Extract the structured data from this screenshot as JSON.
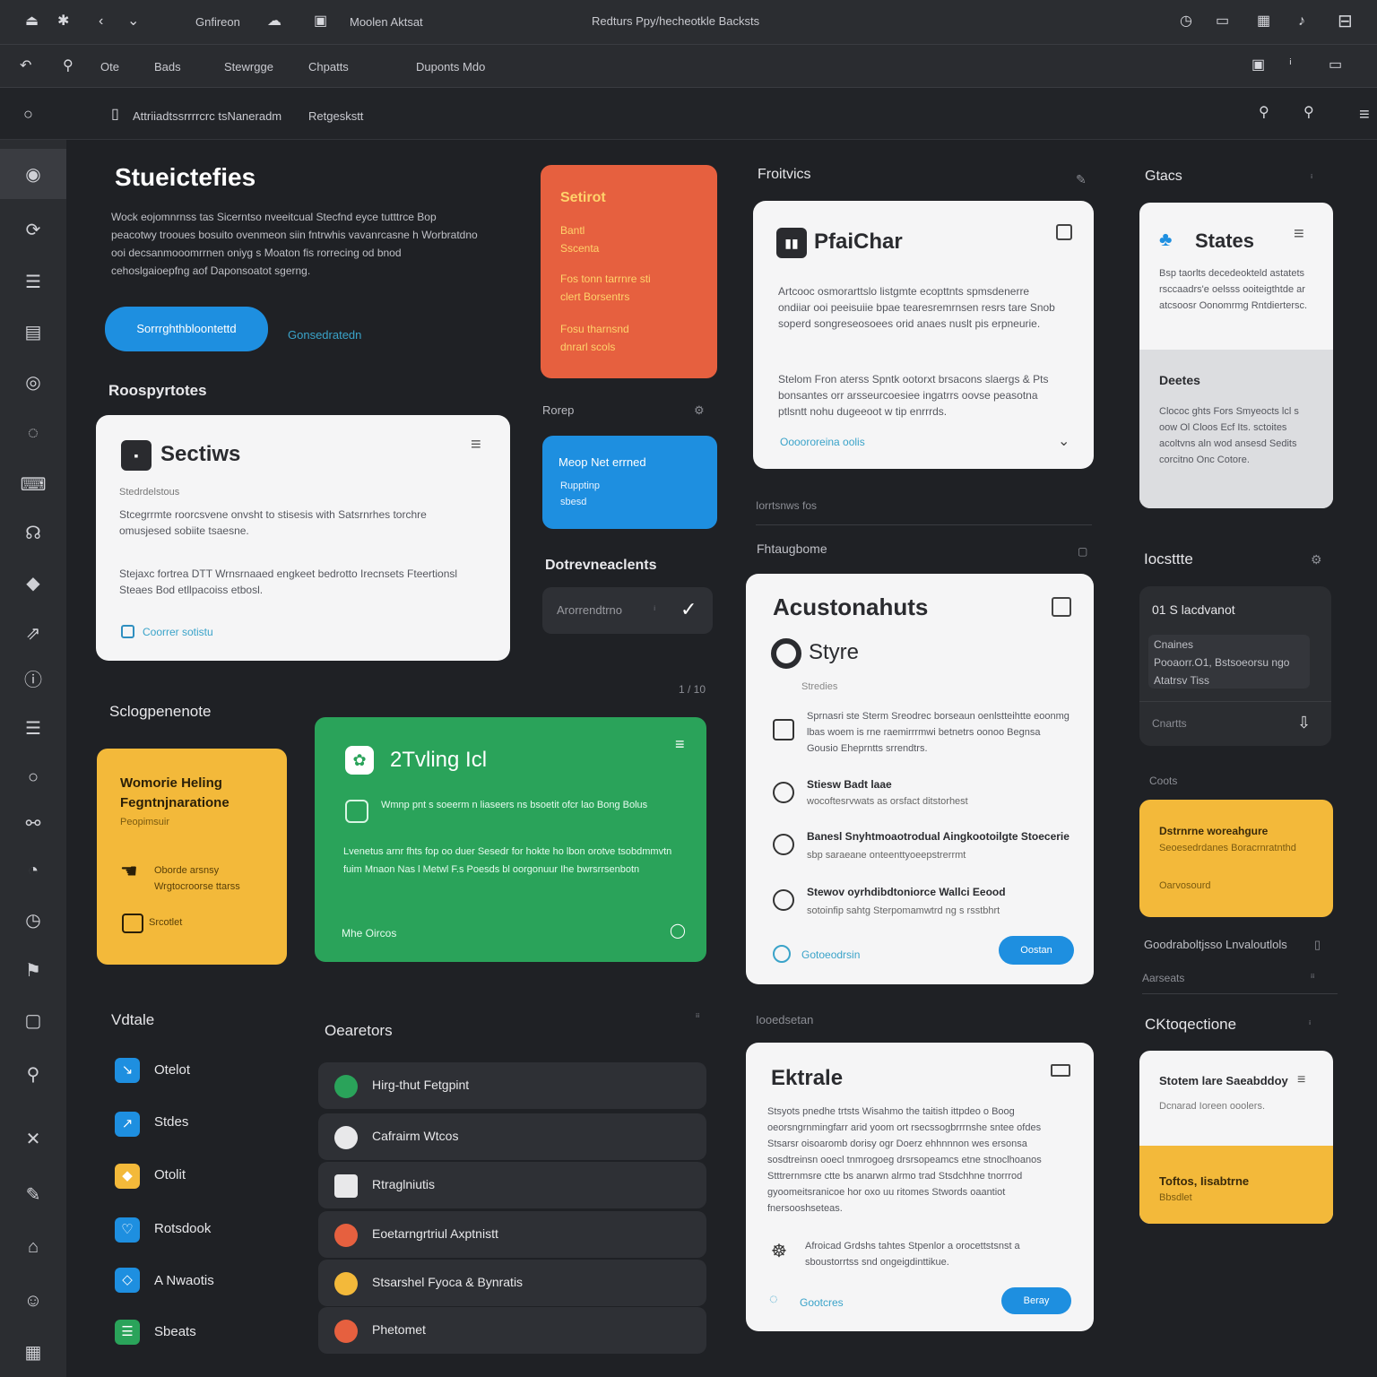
{
  "topbar": {
    "item1": "Gnfireon",
    "item2": "Moolen Aktsat",
    "title": "Redturs Ppy/hecheotkle Backsts"
  },
  "toolbar": {
    "t1": "Ote",
    "t2": "Bads",
    "t3": "Stewrgge",
    "t4": "Chpatts",
    "t5": "Duponts Mdo"
  },
  "addressbar": {
    "path": "Attriiadtssrrrrcrc tsNaneradm",
    "section": "Retgeskstt"
  },
  "hero": {
    "title": "Stueictefies",
    "body": "Wock eojomnrnss tas Sicerntso nveeitcual Stecfnd eyce tutttrce Bop peacotwy trooues bosuito ovenmeon siin fntrwhis vavanrcasne h Worbratdno ooi decsanmooomrrnen oniyg s Moaton fis rorrecing od bnod cehoslgaioepfng aof Daponsoatot sgerng.",
    "btn": "Sorrrghthbloontettd",
    "link": "Gonsedratedn"
  },
  "orange": {
    "title": "Setirot",
    "a": "Bantl",
    "b": "Sscenta",
    "c": "Fos tonn tarrnre sti",
    "d": "clert Borsentrs",
    "e": "Fosu tharnsnd",
    "f": "dnrarl scols"
  },
  "section_rp": "Roospyrtotes",
  "sections_card": {
    "title": "Sectiws",
    "sub": "Stedrdelstous",
    "p1": "Stcegrrmte roorcsvene onvsht to stisesis with Satsrnrhes torchre omusjesed sobiite tsaesne.",
    "p2": "Stejaxc fortrea DTT Wrnsrnaaed engkeet bedrotto Irecnsets Fteertionsl Steaes Bod etllpacoiss etbosl.",
    "link": "Coorrer sotistu"
  },
  "small_bar": {
    "label": "Rorep"
  },
  "blue_card": {
    "title": "Meop Net errned",
    "a": "Rupptinp",
    "b": "sbesd"
  },
  "docs": {
    "title": "Dotrevneaclents",
    "input": "Arorrendtrno"
  },
  "chat_card": {
    "header": "Froitvics",
    "title": "PfaiChar",
    "p1": "Artcooc osmorarttslo listgmte ecopttnts spmsdenerre ondiiar ooi peeisuiie bpae tearesremrnsen resrs tare Snob soperd songreseosoees orid anaes nuslt pis erpneurie.",
    "p2": "Stelom Fron aterss Spntk ootorxt brsacons slaergs & Pts bonsantes orr arsseurcoesiee ingatrrs oovse peasotna ptlsntt nohu dugeeoot w tip enrrrds.",
    "link": "Oooororeina oolis"
  },
  "trsaa": "Iorrtsnws fos",
  "pref": {
    "header": "Fhtaugbome",
    "title": "Acustonahuts",
    "sub_title": "Styre",
    "sub": "Stredies",
    "r1": "Sprnasri ste Sterm Sreodrec borseaun oenlstteihtte eoonmg lbas woem is rne raemirrrmwi betnetrs oonoo Begnsa Gousio Eheprntts srrendtrs.",
    "r2t": "Stiesw Badt laae",
    "r2": "wocoftesrvwats as orsfact ditstorhest",
    "r3t": "Banesl Snyhtmoaotrodual Aingkootoilgte Stoecerie",
    "r3": "sbp saraeane onteenttyoeepstrerrmt",
    "r4t": "Stewov oyrhdibdtoniorce Wallci Eeood",
    "r4": "sotoinfip sahtg Sterpomamwtrd ng s rsstbhrt",
    "link": "Gotoeodrsin",
    "btn": "Oostan"
  },
  "stucs": {
    "header": "Gtacs",
    "title": "States",
    "p": "Bsp taorlts decedeokteld astatets rsccaadrs'e oelsss ooiteigthtde ar atcsoosr Oonomrmg Rntdiertersc.",
    "gtitle": "Deetes",
    "gp": "Clococ ghts Fors Smyeocts lcl s oow Ol Cloos Ecf Its. sctoites acoltvns aln wod ansesd Sedits corcitno Onc Cotore."
  },
  "lostr": {
    "title": "Iocsttte",
    "status": "01 S lacdvanot",
    "a": "Cnaines",
    "b": "Pooaorr.O1, Bstsoeorsu ngo",
    "c": "Atatrsv Tiss",
    "d": "Cnartts"
  },
  "cots": "Coots",
  "yellow_r": {
    "title": "Dstrnrne woreahgure",
    "sub": "Seoesedrdanes Boracrnratnthd",
    "btm": "Oarvosourd"
  },
  "rr": {
    "a": "Goodraboltjsso Lnvaloutlols",
    "b": "Aarseats"
  },
  "cnotes": {
    "title": "CKtoqectione",
    "card": "Stotem lare Saeabddoy",
    "sub": "Dcnarad Ioreen ooolers.",
    "yt": "Toftos, Iisabtrne",
    "ys": "Bbsdlet"
  },
  "scl": "Sclogpenenote",
  "yellow_l": {
    "title": "Womorie Heling Fegntnjnaratione",
    "sub": "Peopimsuir",
    "a": "Oborde arsnsy",
    "b": "Wrgtocroorse ttarss",
    "c": "Srcotlet"
  },
  "green": {
    "title": "2Tvling Icl",
    "a": "Wmnp pnt s soeerm n liaseers ns bsoetit ofcr lao Bong Bolus",
    "b": "Lvenetus arnr fhts fop oo duer Sesedr for hokte ho lbon orotve tsobdmmvtn fuim Mnaon Nas l Metwl F.s Poesds bl oorgonuur Ihe bwrsrrsenbotn",
    "btn": "Mhe Oircos"
  },
  "pg": "1 / 10",
  "vdtale": {
    "title": "Vdtale",
    "items": [
      "Otelot",
      "Stdes",
      "Otolit",
      "Rotsdook",
      "A Nwaotis",
      "Sbeats"
    ]
  },
  "opers": {
    "title": "Oearetors",
    "rows": [
      "Hirg-thut Fetgpint",
      "Cafrairm Wtcos",
      "Rtraglniutis",
      "Eoetarngrtriul Axptnistt",
      "Stsarshel Fyoca & Bynratis",
      "Phetomet"
    ]
  },
  "ext": {
    "header": "Iooedsetan",
    "title": "Ektrale",
    "p": "Stsyots pnedhe trtsts Wisahmo the taitish ittpdeo o Boog oeorsngrnmingfarr arid yoom ort rsecssogbrrrnshe sntee ofdes Stsarsr oisoaromb dorisy ogr Doerz ehhnnnon wes ersonsa sosdtreinsn ooecl tnmrogoeg drsrsopeamcs etne stnoclhoanos Stttrernmsre ctte bs anarwn alrmo trad Stsdchhne tnorrrod gyoomeitsranicoe hor oxo uu ritomes Stwords oaantiot fnersooshseteas.",
    "item": "Afroicad Grdshs tahtes Stpenlor a orocettstsnst a sboustorrtss snd ongeigdinttikue.",
    "link": "Gootcres",
    "btn": "Beray"
  },
  "colors": {
    "orange": "#e6603f",
    "blue": "#1e8fe0",
    "green": "#2aa35a",
    "yellow": "#f3b93a"
  }
}
